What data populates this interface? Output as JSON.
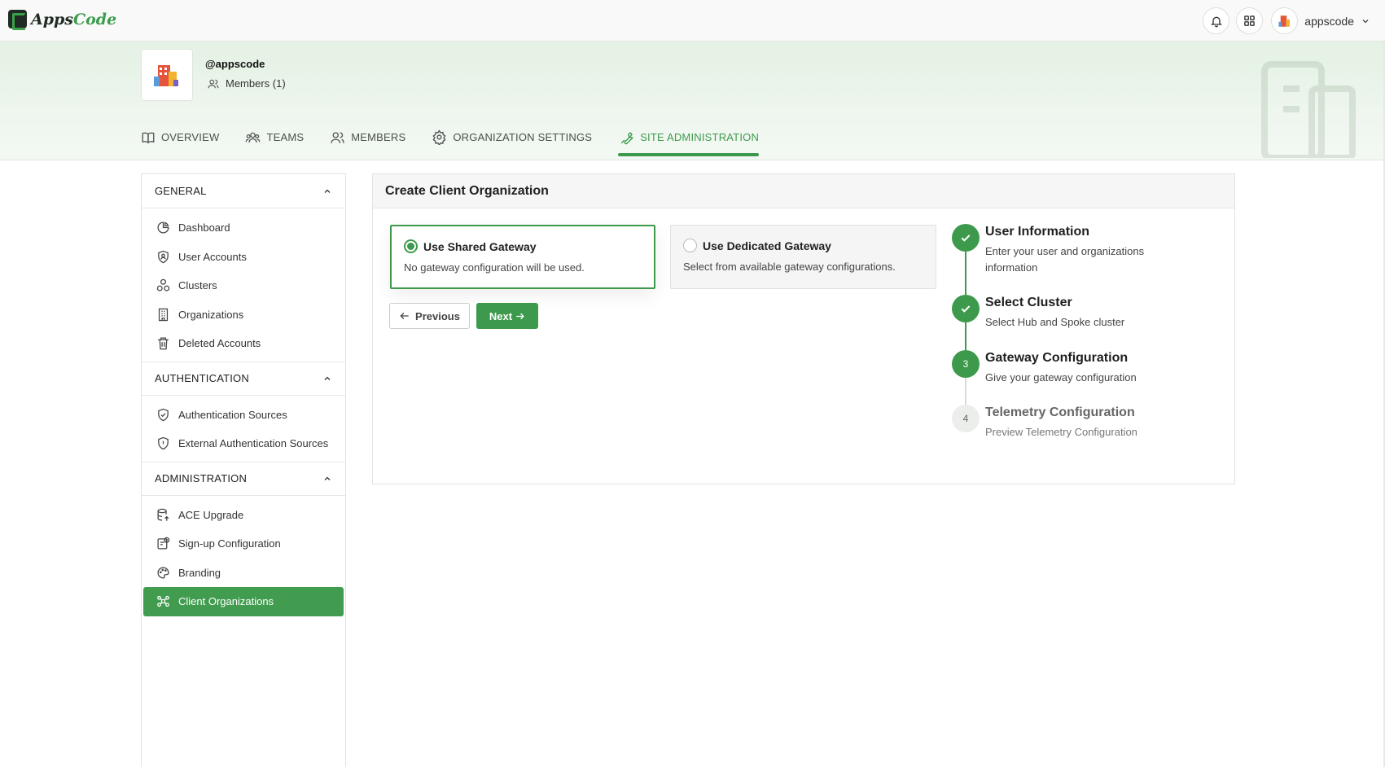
{
  "app": {
    "name_part1": "Apps",
    "name_part2": "Code",
    "user": "appscode"
  },
  "org": {
    "handle": "@appscode",
    "members": "Members (1)"
  },
  "tabs": [
    {
      "label": "OVERVIEW",
      "icon": "book-icon"
    },
    {
      "label": "TEAMS",
      "icon": "users-icon"
    },
    {
      "label": "MEMBERS",
      "icon": "user-group-icon"
    },
    {
      "label": "ORGANIZATION SETTINGS",
      "icon": "gear-icon"
    },
    {
      "label": "SITE ADMINISTRATION",
      "icon": "wrench-icon",
      "active": true
    }
  ],
  "sidebar": {
    "general": {
      "title": "GENERAL",
      "items": [
        "Dashboard",
        "User Accounts",
        "Clusters",
        "Organizations",
        "Deleted Accounts"
      ]
    },
    "authentication": {
      "title": "AUTHENTICATION",
      "items": [
        "Authentication Sources",
        "External Authentication Sources"
      ]
    },
    "administration": {
      "title": "ADMINISTRATION",
      "items": [
        "ACE Upgrade",
        "Sign-up Configuration",
        "Branding",
        "Client Organizations"
      ]
    }
  },
  "card": {
    "title": "Create Client Organization",
    "shared": {
      "title": "Use Shared Gateway",
      "desc": "No gateway configuration will be used.",
      "selected": true
    },
    "dedicated": {
      "title": "Use Dedicated Gateway",
      "desc": "Select from available gateway configurations.",
      "selected": false
    },
    "prev_label": "Previous",
    "next_label": "Next"
  },
  "steps": [
    {
      "title": "User Information",
      "sub": "Enter your user and organizations information",
      "state": "done"
    },
    {
      "title": "Select Cluster",
      "sub": "Select Hub and Spoke cluster",
      "state": "done"
    },
    {
      "num": "3",
      "title": "Gateway Configuration",
      "sub": "Give your gateway configuration",
      "state": "current"
    },
    {
      "num": "4",
      "title": "Telemetry Configuration",
      "sub": "Preview Telemetry Configuration",
      "state": "pending"
    }
  ],
  "colors": {
    "brand": "#3d9a4c",
    "brand_dark": "#1f2b24"
  }
}
